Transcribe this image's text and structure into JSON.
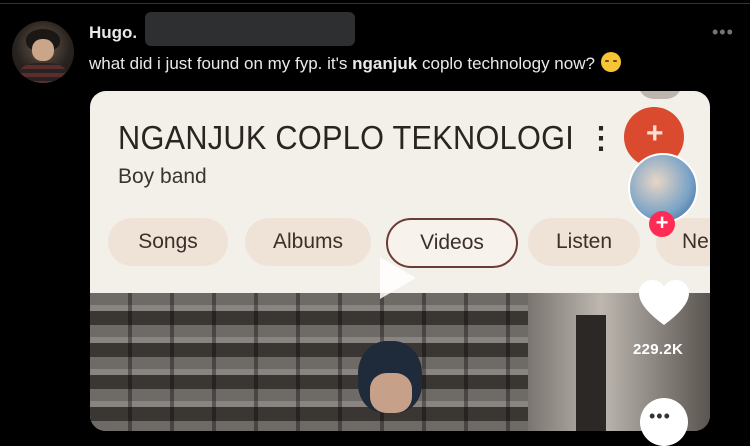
{
  "tweet": {
    "author_name": "Hugo.",
    "text_before": "what did i just found on my fyp. it's ",
    "text_bold": "nganjuk",
    "text_after": " coplo technology now?",
    "emoji_icon": "pensive-face-icon",
    "more_icon": "more-horizontal-icon",
    "more_label": "•••"
  },
  "media": {
    "artist_title": "NGANJUK COPLO TEKNOLOGI",
    "artist_subtitle": "Boy band",
    "kebab_label": "⋮",
    "chips": [
      {
        "label": "Songs"
      },
      {
        "label": "Albums"
      },
      {
        "label": "Videos",
        "active": true
      },
      {
        "label": "Listen"
      },
      {
        "label": "Ne"
      }
    ],
    "play_icon": "play-icon",
    "likes_count": "229.2K",
    "follow_plus": "+",
    "accent_color": "#fe2c55"
  }
}
